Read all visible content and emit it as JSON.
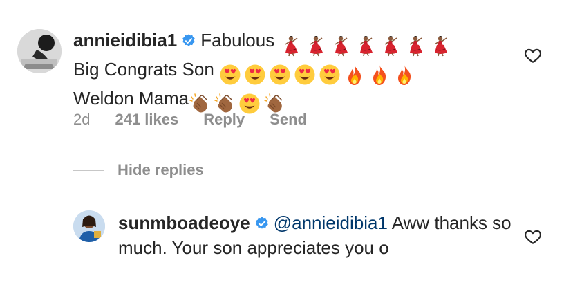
{
  "comment1": {
    "username": "annieidibia1",
    "line1_text": "Fabulous",
    "line2_text": "Big Congrats Son",
    "line3_text": "Weldon Mama",
    "line1_emojis": [
      "dancer-emoji",
      "dancer-emoji",
      "dancer-emoji",
      "dancer-emoji",
      "dancer-emoji",
      "dancer-emoji",
      "dancer-emoji"
    ],
    "line2_emojis": [
      "heart-eyes-emoji",
      "heart-eyes-emoji",
      "heart-eyes-emoji",
      "heart-eyes-emoji",
      "heart-eyes-emoji",
      "fire-emoji",
      "fire-emoji",
      "fire-emoji"
    ],
    "line3_emojis": [
      "clap-emoji",
      "clap-emoji",
      "heart-eyes-emoji",
      "clap-emoji"
    ],
    "time": "2d",
    "likes": "241 likes",
    "reply_label": "Reply",
    "send_label": "Send"
  },
  "hide_replies_label": "Hide replies",
  "comment2": {
    "username": "sunmboadeoye",
    "mention": "@annieidibia1",
    "text": " Aww thanks so much. Your son appreciates you o"
  },
  "colors": {
    "text": "#262626",
    "secondary": "#8e8e8e",
    "mention": "#00376b",
    "verified": "#3897f0"
  }
}
